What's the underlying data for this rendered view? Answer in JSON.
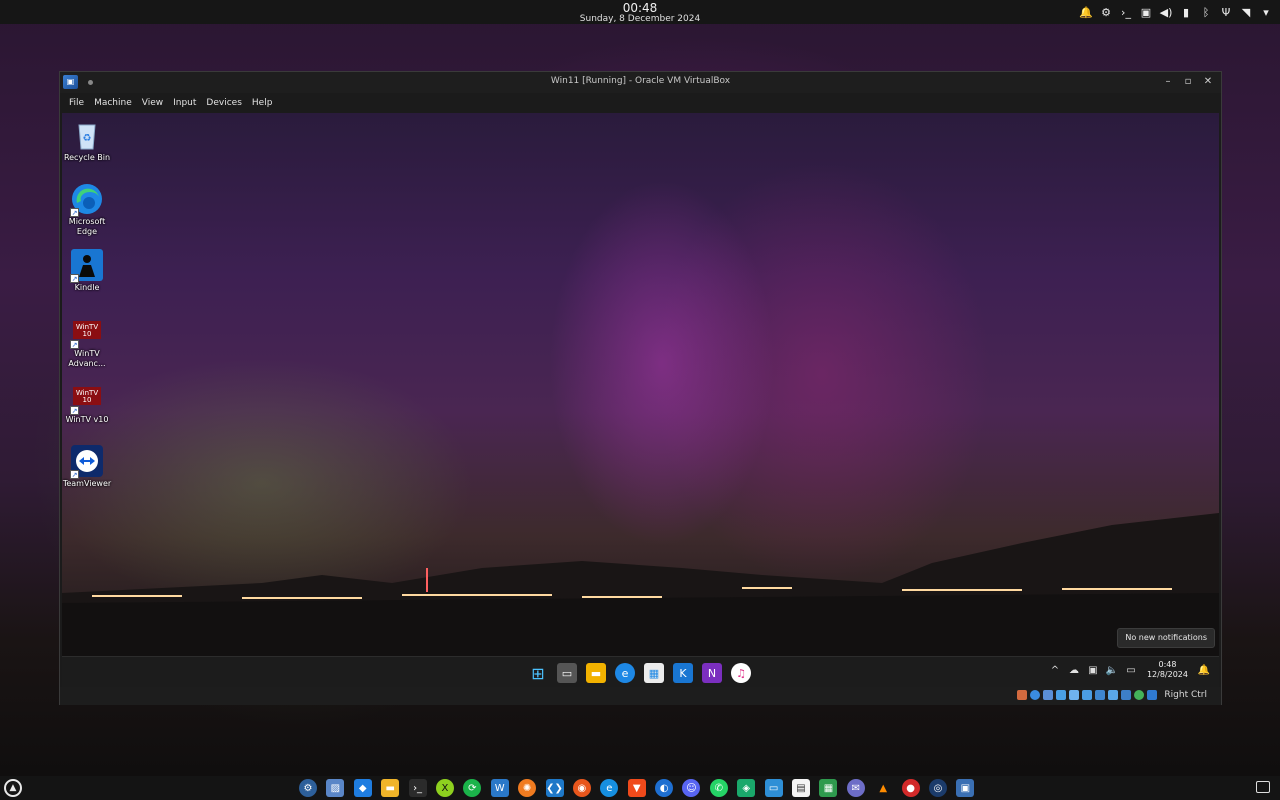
{
  "host": {
    "time": "00:48",
    "date": "Sunday, 8 December 2024",
    "tray_icons": [
      "bell-icon",
      "network-manager-icon",
      "terminal-icon",
      "clipboard-icon",
      "volume-icon",
      "battery-icon",
      "bluetooth-icon",
      "usb-icon",
      "wifi-icon",
      "menu-down-icon"
    ],
    "dock_apps": [
      "settings",
      "photo-viewer",
      "software-store",
      "files",
      "terminal",
      "xbox",
      "sync",
      "writer",
      "sunflower",
      "vscode",
      "firefox",
      "edge",
      "brave",
      "sonic",
      "discord",
      "whatsapp",
      "maps",
      "remote-desktop",
      "text-editor",
      "spreadsheet",
      "telegram-like",
      "vlc",
      "app-red",
      "steam",
      "virtualbox"
    ]
  },
  "vm": {
    "title": "Win11 [Running] - Oracle VM VirtualBox",
    "menu": [
      "File",
      "Machine",
      "View",
      "Input",
      "Devices",
      "Help"
    ],
    "host_key": "Right Ctrl"
  },
  "guest": {
    "desktop_icons": [
      {
        "label": "Recycle Bin",
        "icon": "recycle-bin-icon"
      },
      {
        "label": "Microsoft Edge",
        "icon": "edge-icon"
      },
      {
        "label": "Kindle",
        "icon": "kindle-icon"
      },
      {
        "label": "WinTV Advanc...",
        "icon": "wintv-icon"
      },
      {
        "label": "WinTV v10",
        "icon": "wintv-icon"
      },
      {
        "label": "TeamViewer",
        "icon": "teamviewer-icon"
      }
    ],
    "wintv_badge": "WinTV\n10",
    "notification": "No new notifications",
    "taskbar_time": "0:48",
    "taskbar_date": "12/8/2024"
  },
  "colors": {
    "accent": "#1e88ff",
    "vbox_blue": "#2d6cc0"
  }
}
